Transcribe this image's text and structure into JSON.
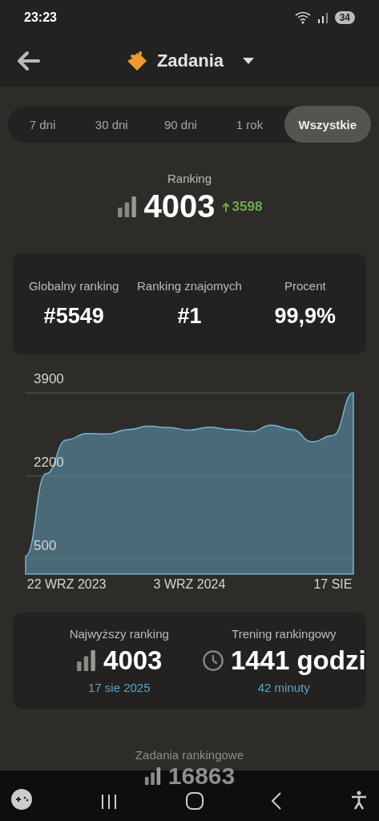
{
  "status_bar": {
    "time": "23:23",
    "battery": "34"
  },
  "header": {
    "title": "Zadania"
  },
  "tabs": [
    {
      "label": "7 dni",
      "selected": false
    },
    {
      "label": "30 dni",
      "selected": false
    },
    {
      "label": "90 dni",
      "selected": false
    },
    {
      "label": "1 rok",
      "selected": false
    },
    {
      "label": "Wszystkie",
      "selected": true
    }
  ],
  "ranking": {
    "label": "Ranking",
    "value": "4003",
    "change": "3598"
  },
  "stats": [
    {
      "label": "Globalny ranking",
      "value": "#5549"
    },
    {
      "label": "Ranking znajomych",
      "value": "#1"
    },
    {
      "label": "Procent",
      "value": "99,9%"
    }
  ],
  "chart": {
    "chart_data": {
      "type": "area",
      "categories": [
        null,
        null,
        "22 WRZ 2023",
        null,
        null,
        null,
        null,
        null,
        "3 WRZ 2024",
        null,
        null,
        null,
        null,
        null,
        null,
        "17 SIE",
        null
      ],
      "series": [
        {
          "color": "#6fb6d6",
          "values": [
            570,
            2250,
            2940,
            3070,
            3060,
            3150,
            3220,
            3190,
            3140,
            3200,
            3150,
            3110,
            3240,
            3150,
            2900,
            3030,
            3900
          ]
        }
      ],
      "ylim": [
        200,
        3900
      ],
      "yticks": [
        500,
        2200,
        3900
      ],
      "grid": true
    }
  },
  "summary": [
    {
      "kind": "rank",
      "label": "Najwyższy ranking",
      "value": "4003",
      "sub": "17 sie 2025"
    },
    {
      "kind": "time",
      "label": "Trening rankingowy",
      "value": "1441 godzi",
      "sub": "42 minuty"
    }
  ],
  "behind_nav": {
    "label": "Zadania rankingowe",
    "value": "16863"
  }
}
